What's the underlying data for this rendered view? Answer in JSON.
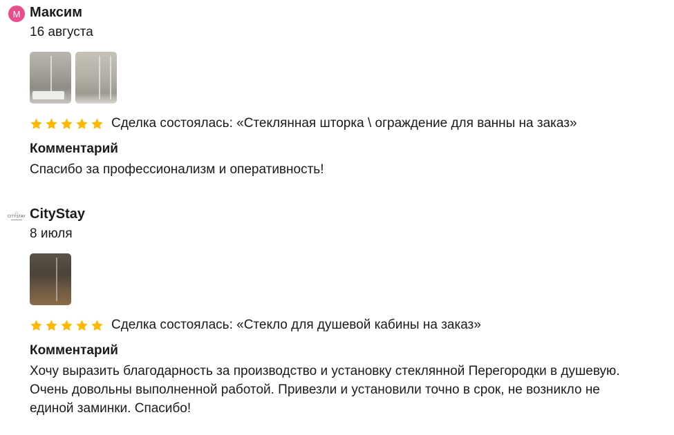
{
  "reviews": [
    {
      "avatar_letter": "М",
      "name": "Максим",
      "date": "16 августа",
      "photos": [
        "bathtub-glass-screen-photo",
        "bathtub-glass-screen-photo"
      ],
      "rating": 5,
      "deal": "Сделка состоялась: «Стеклянная шторка \\ ограждение для ванны на заказ»",
      "comment_title": "Комментарий",
      "comment": "Спасибо за профессионализм и оперативность!"
    },
    {
      "avatar_logo_text": "CITYSTAY",
      "name": "CityStay",
      "date": "8 июля",
      "photos": [
        "shower-glass-partition-photo"
      ],
      "rating": 5,
      "deal": "Сделка состоялась: «Стекло для душевой кабины на заказ»",
      "comment_title": "Комментарий",
      "comment": "Хочу выразить благодарность за производство и установку стеклянной Перегородки в душевую. Очень довольны выполненной работой. Привезли и установили точно в срок, не возникло не единой заминки. Спасибо!"
    }
  ],
  "colors": {
    "star": "#ffb800",
    "avatar_pink": "#e84f8a"
  }
}
